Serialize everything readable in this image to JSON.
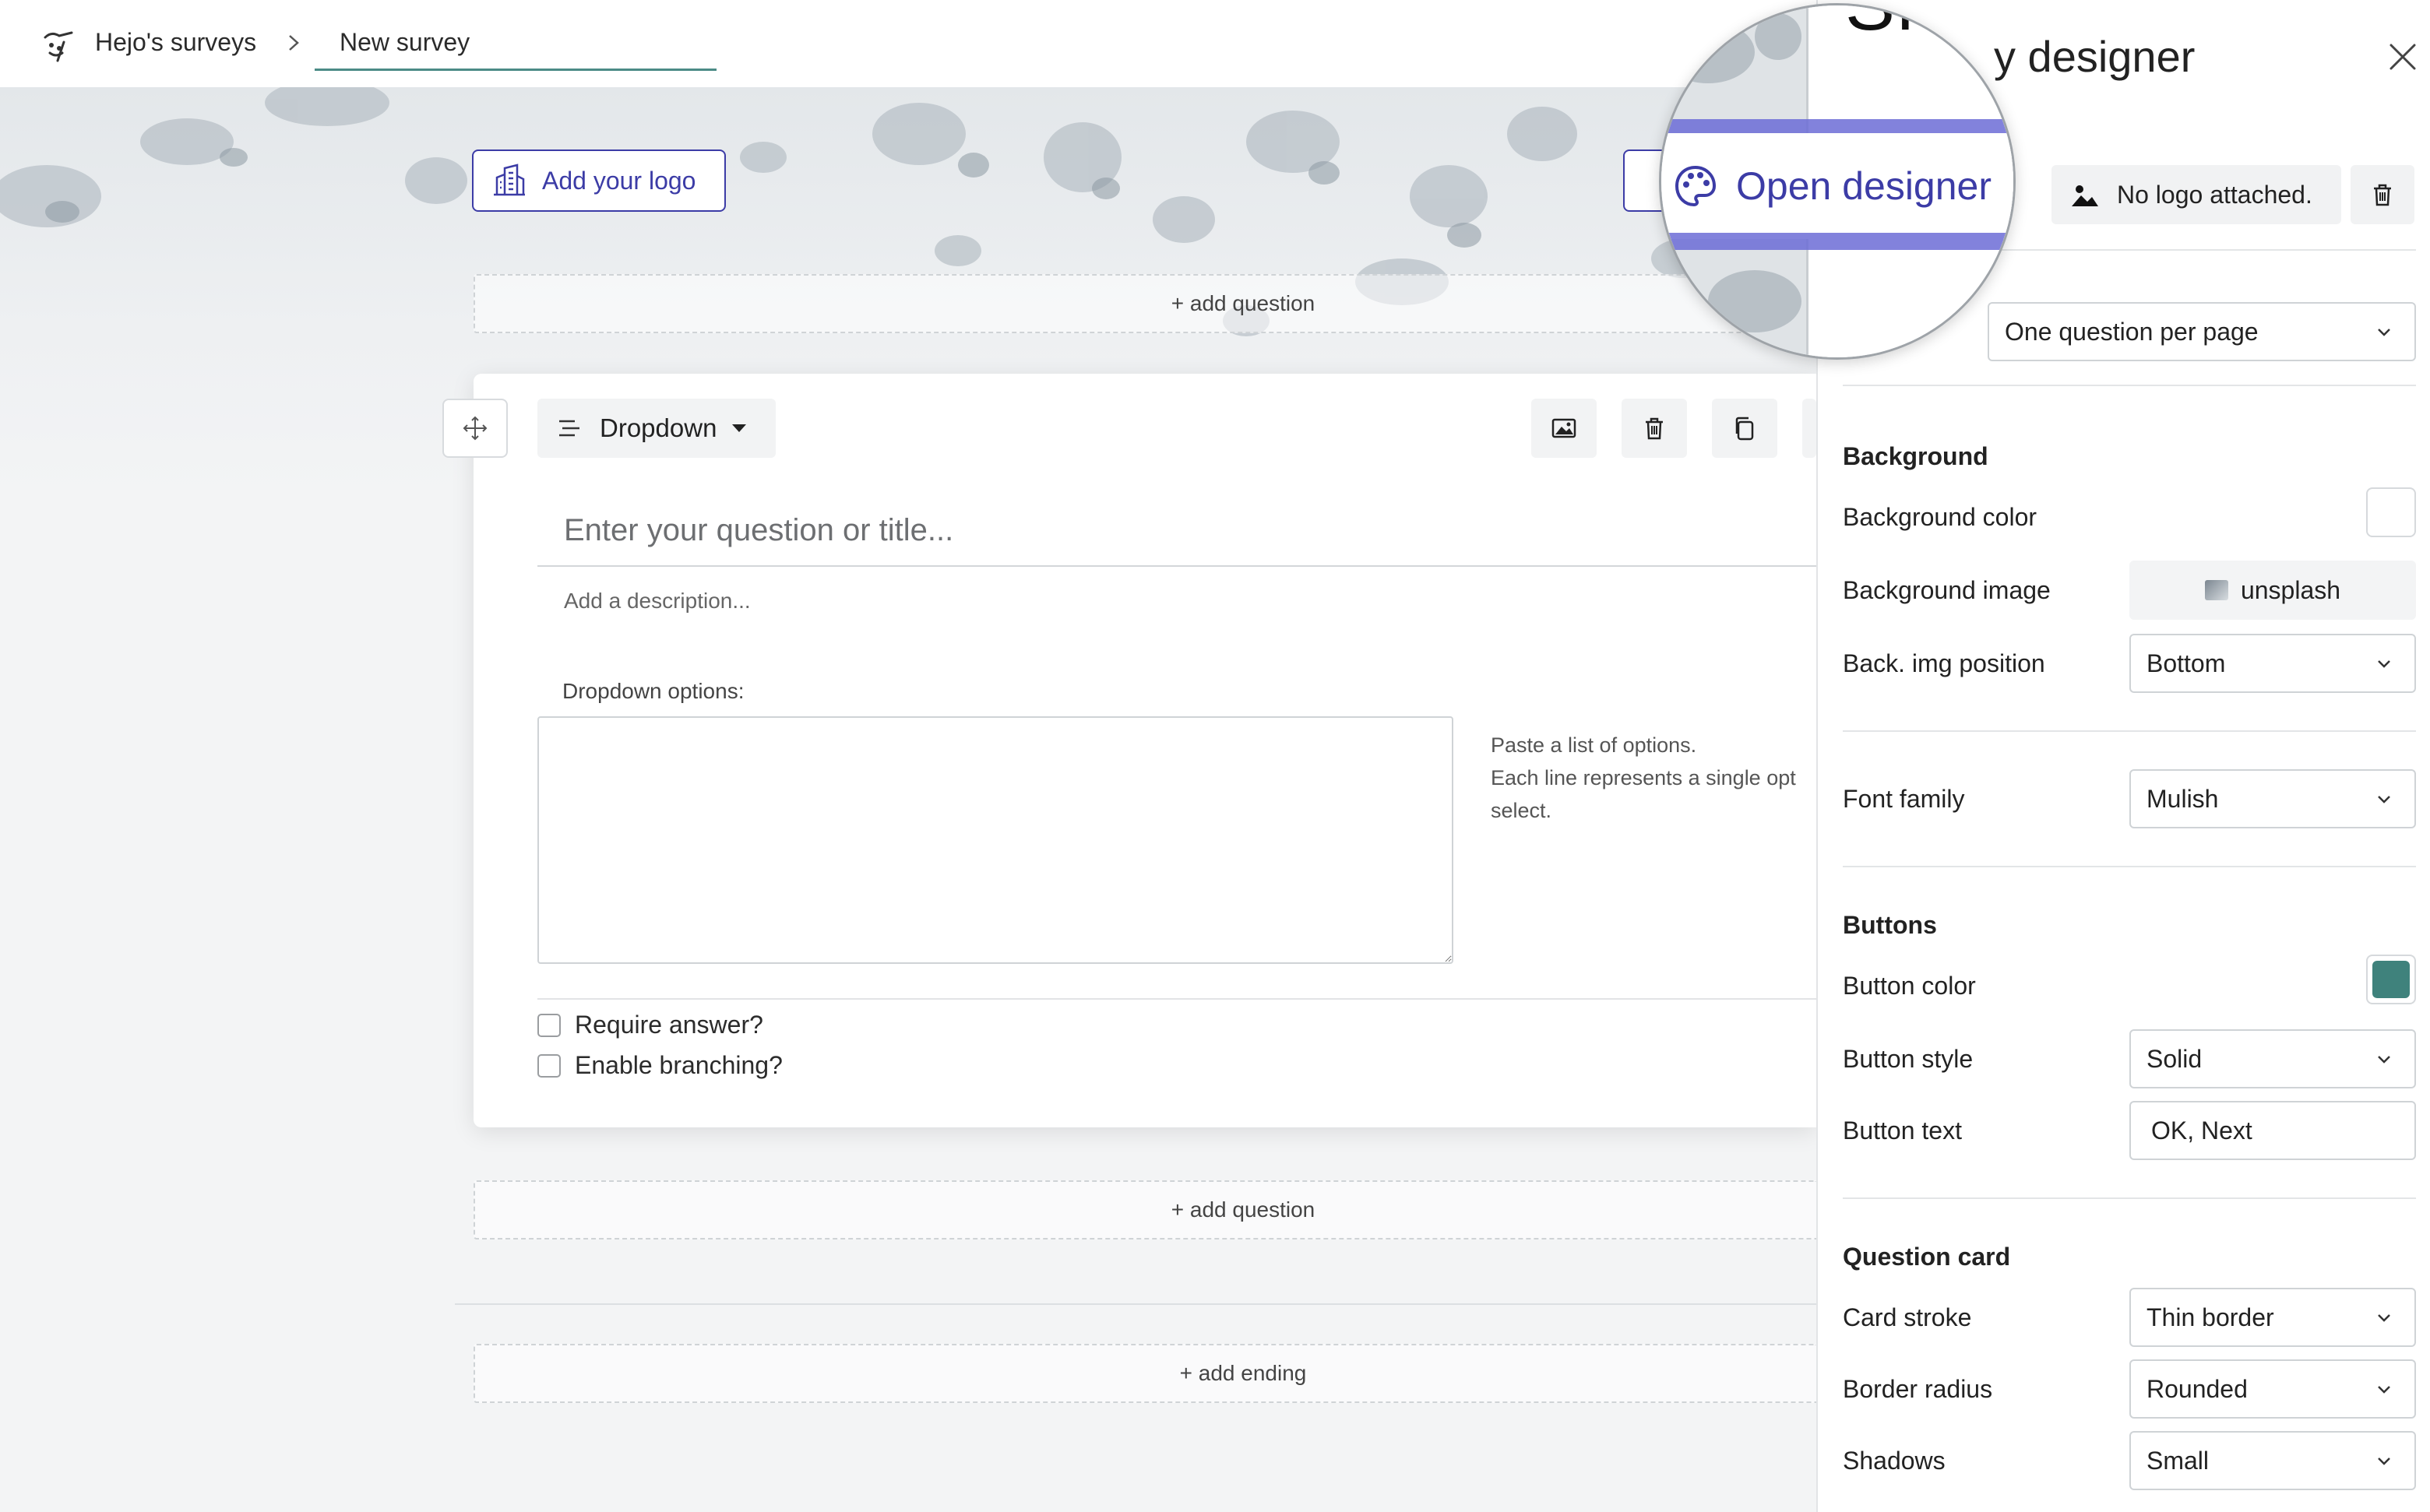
{
  "breadcrumb": {
    "home": "Hejo's surveys",
    "current": "New survey"
  },
  "canvas": {
    "add_logo_label": "Add your logo",
    "add_question_label": "+ add question",
    "add_ending_label": "+ add ending"
  },
  "question_card": {
    "type_label": "Dropdown",
    "title_placeholder": "Enter your question or title...",
    "description_placeholder": "Add a description...",
    "options_label": "Dropdown options:",
    "options_help": [
      "Paste a list of options.",
      "Each line represents a single opt",
      "select."
    ],
    "require_answer_label": "Require answer?",
    "enable_branching_label": "Enable branching?"
  },
  "magnifier": {
    "open_designer_label": "Open designer",
    "title_fragment": "Sı"
  },
  "designer": {
    "title": "y designer",
    "logo_status": "No logo attached.",
    "layout_value": "One question per page",
    "background": {
      "heading": "Background",
      "color_label": "Background color",
      "color_value": "#ffffff",
      "image_label": "Background image",
      "image_value": "unsplash",
      "position_label": "Back. img position",
      "position_value": "Bottom"
    },
    "font": {
      "label": "Font family",
      "value": "Mulish"
    },
    "buttons": {
      "heading": "Buttons",
      "color_label": "Button color",
      "color_value": "#3f827c",
      "style_label": "Button style",
      "style_value": "Solid",
      "text_label": "Button text",
      "text_value": "OK, Next"
    },
    "question_card": {
      "heading": "Question card",
      "stroke_label": "Card stroke",
      "stroke_value": "Thin border",
      "radius_label": "Border radius",
      "radius_value": "Rounded",
      "shadows_label": "Shadows",
      "shadows_value": "Small"
    }
  },
  "colors": {
    "accent": "#3c3ca6",
    "teal": "#4b8b86",
    "button_color": "#3f827c"
  }
}
